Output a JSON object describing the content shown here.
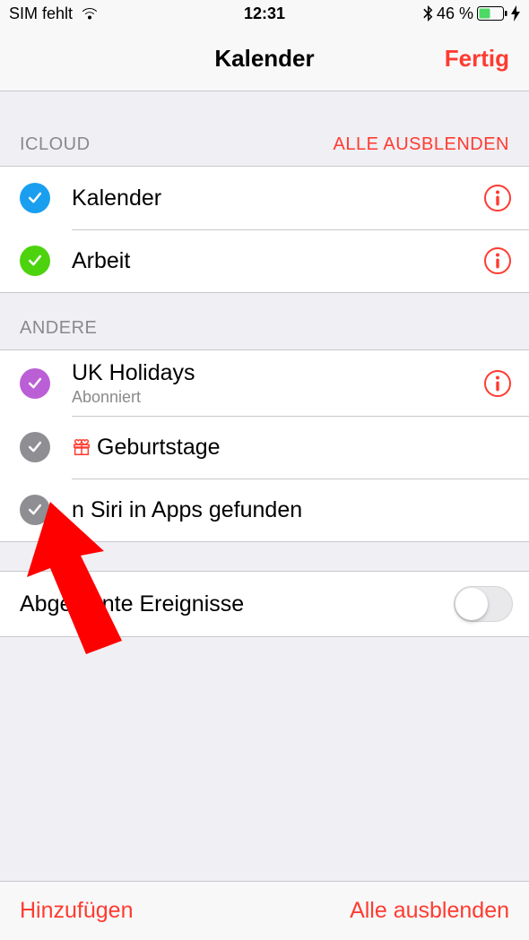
{
  "status": {
    "carrier": "SIM fehlt",
    "time": "12:31",
    "battery_pct": "46 %"
  },
  "nav": {
    "title": "Kalender",
    "done": "Fertig"
  },
  "sections": {
    "icloud": {
      "label": "ICLOUD",
      "action": "ALLE AUSBLENDEN"
    },
    "other": {
      "label": "ANDERE"
    }
  },
  "calendars": {
    "icloud": [
      {
        "name": "Kalender",
        "color": "#1a9ff0"
      },
      {
        "name": "Arbeit",
        "color": "#4cd30e"
      }
    ],
    "other": [
      {
        "name": "UK Holidays",
        "sub": "Abonniert",
        "color": "#bb5fd6",
        "info": true
      },
      {
        "name": "Geburtstage",
        "color": "#8e8e93",
        "gift": true
      },
      {
        "name": "n Siri in Apps gefunden",
        "color": "#8e8e93"
      }
    ]
  },
  "declined": {
    "label": "Abgelehnte Ereignisse",
    "on": false
  },
  "toolbar": {
    "add": "Hinzufügen",
    "hide_all": "Alle ausblenden"
  }
}
